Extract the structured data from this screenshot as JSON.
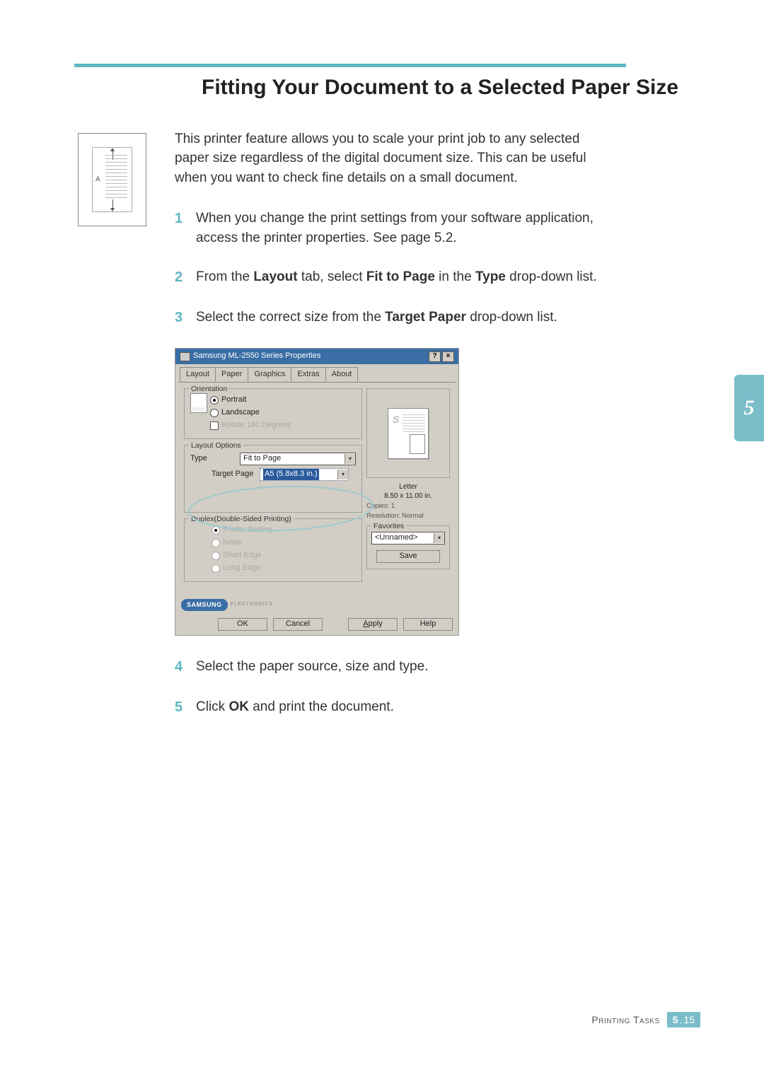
{
  "page": {
    "heading": "Fitting Your Document to a Selected Paper Size",
    "intro": "This printer feature allows you to scale your print job to any selected paper size regardless of the digital document size. This can be useful when you want to check fine details on a small document.",
    "margin_icon_label": "A",
    "side_tab": "5",
    "footer_label": "Printing Tasks",
    "footer_chapter": "5",
    "footer_page": "15"
  },
  "steps": {
    "s1": {
      "num": "1",
      "text": "When you change the print settings from your software application, access the printer properties. See page 5.2."
    },
    "s2": {
      "num": "2",
      "pre": "From the ",
      "b1": "Layout",
      "mid1": " tab, select ",
      "b2": "Fit to Page",
      "mid2": " in the ",
      "b3": "Type",
      "post": " drop-down list."
    },
    "s3": {
      "num": "3",
      "pre": "Select the correct size from the ",
      "b1": "Target Paper",
      "post": " drop-down list."
    },
    "s4": {
      "num": "4",
      "text": "Select the paper source, size and type."
    },
    "s5": {
      "num": "5",
      "pre": "Click ",
      "b1": "OK",
      "post": " and print the document."
    }
  },
  "dialog": {
    "title": "Samsung ML-2550 Series Properties",
    "help_btn": "?",
    "close_btn": "×",
    "tabs": {
      "layout": "Layout",
      "paper": "Paper",
      "graphics": "Graphics",
      "extras": "Extras",
      "about": "About"
    },
    "orientation": {
      "title": "Orientation",
      "portrait": "Portrait",
      "landscape": "Landscape",
      "rotate": "Rotate 180 Degrees"
    },
    "layout_options": {
      "title": "Layout Options",
      "type_label": "Type",
      "type_value": "Fit to Page",
      "target_label": "Target Page",
      "target_value": "A5 (5.8x8.3 in.)"
    },
    "duplex": {
      "title": "Duplex(Double-Sided Printing)",
      "printer": "Printer Setting",
      "none": "None",
      "short": "Short Edge",
      "long": "Long Edge"
    },
    "preview": {
      "paper_name": "Letter",
      "paper_dim": "8.50 x 11.00 in.",
      "copies": "Copies: 1",
      "resolution": "Resolution: Normal"
    },
    "favorites": {
      "title": "Favorites",
      "value": "<Unnamed>",
      "save": "Save"
    },
    "brand": {
      "logo": "SAMSUNG",
      "sub": "ELECTRONICS"
    },
    "buttons": {
      "ok": "OK",
      "cancel": "Cancel",
      "apply": "Apply",
      "help": "Help"
    }
  }
}
